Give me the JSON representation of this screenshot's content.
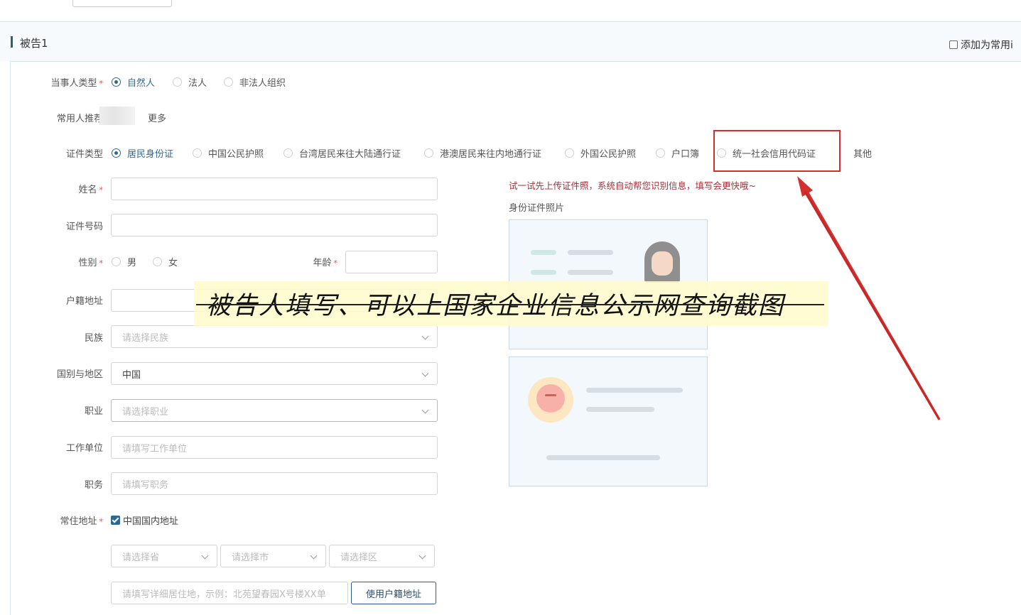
{
  "header": {
    "title": "被告1",
    "add_common_label": "添加为常用i"
  },
  "party_type": {
    "label": "当事人类型",
    "required": "*",
    "options": [
      "自然人",
      "法人",
      "非法人组织"
    ],
    "selected": "自然人"
  },
  "common_person": {
    "label": "常用人推荐",
    "more": "更多"
  },
  "id_type": {
    "label": "证件类型",
    "options": [
      "居民身份证",
      "中国公民护照",
      "台湾居民来往大陆通行证",
      "港澳居民来往内地通行证",
      "外国公民护照",
      "户口簿",
      "统一社会信用代码证",
      "其他"
    ],
    "selected": "居民身份证"
  },
  "form": {
    "name_label": "姓名",
    "id_number_label": "证件号码",
    "gender_label": "性别",
    "gender_options": [
      "男",
      "女"
    ],
    "age_label": "年龄",
    "household_label": "户籍地址",
    "ethnicity_label": "民族",
    "ethnicity_placeholder": "请选择民族",
    "country_label": "国别与地区",
    "country_value": "中国",
    "occupation_label": "职业",
    "occupation_placeholder": "请选择职业",
    "workplace_label": "工作单位",
    "workplace_placeholder": "请填写工作单位",
    "position_label": "职务",
    "position_placeholder": "请填写职务",
    "residence_label": "常住地址",
    "domestic_checkbox": "中国国内地址",
    "province_placeholder": "请选择省",
    "city_placeholder": "请选择市",
    "district_placeholder": "请选择区",
    "detail_placeholder": "请填写详细居住地，示例：北苑望春园X号楼XX单",
    "use_household_button": "使用户籍地址",
    "required": "*"
  },
  "upload": {
    "hint": "试一试先上传证件照，系统自动帮您识别信息，填写会更快哦~",
    "photo_label": "身份证件照片"
  },
  "annotation": {
    "banner_text": "被告人填写、可以上国家企业信息公示网查询截图"
  },
  "colors": {
    "accent": "#2d6a93",
    "highlight_red": "#d22f2f",
    "hint_red": "#a3303a"
  }
}
